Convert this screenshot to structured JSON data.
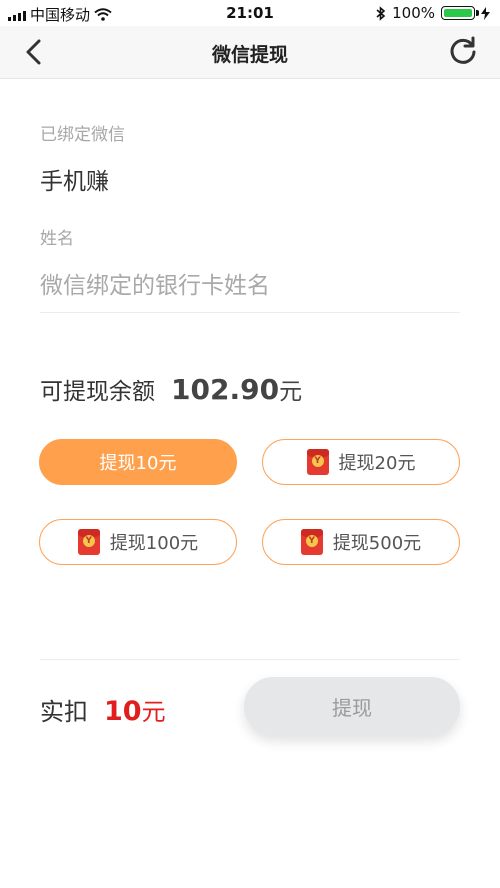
{
  "status_bar": {
    "carrier": "中国移动",
    "time": "21:01",
    "battery": "100%"
  },
  "nav": {
    "title": "微信提现"
  },
  "form": {
    "bound_wechat_label": "已绑定微信",
    "bound_wechat_value": "手机赚",
    "name_label": "姓名",
    "name_placeholder": "微信绑定的银行卡姓名"
  },
  "balance": {
    "label": "可提现余额",
    "amount": "102.90",
    "unit": "元"
  },
  "options": [
    {
      "label": "提现10元",
      "selected": true,
      "has_red_packet": false
    },
    {
      "label": "提现20元",
      "selected": false,
      "has_red_packet": true
    },
    {
      "label": "提现100元",
      "selected": false,
      "has_red_packet": true
    },
    {
      "label": "提现500元",
      "selected": false,
      "has_red_packet": true
    }
  ],
  "footer": {
    "deduct_label": "实扣",
    "deduct_amount": "10",
    "deduct_unit": "元",
    "submit_label": "提现"
  },
  "colors": {
    "accent": "#ffa04d",
    "amount_red": "#e01e1e",
    "battery_green": "#2cc84a"
  }
}
